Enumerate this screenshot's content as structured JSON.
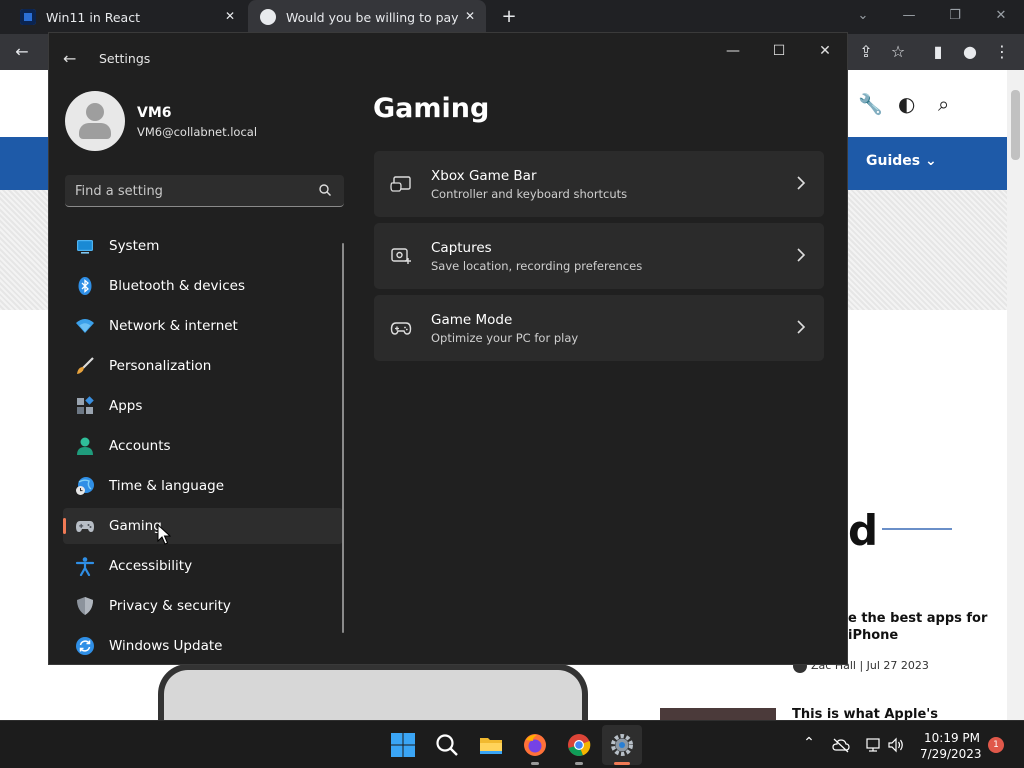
{
  "browser": {
    "tabs": [
      {
        "title": "Win11 in React",
        "favicon_color": "#2b6fd6"
      },
      {
        "title": "Would you be willing to pay a hig",
        "favicon_color": "#1e5aa8"
      }
    ],
    "close_glyph": "✕",
    "new_tab_glyph": "+"
  },
  "webpage": {
    "nav_guides": "Guides",
    "heading_fragment": "d",
    "article_title": "e the best apps for iPhone",
    "article_meta": "Zac Hall | Jul 27 2023",
    "article2_title": "This is what Apple's"
  },
  "settings": {
    "window_title": "Settings",
    "user": {
      "name": "VM6",
      "email": "VM6@collabnet.local"
    },
    "search_placeholder": "Find a setting",
    "accent_color": "#f07a55",
    "nav": [
      {
        "label": "System",
        "icon": "system-icon"
      },
      {
        "label": "Bluetooth & devices",
        "icon": "bluetooth-icon"
      },
      {
        "label": "Network & internet",
        "icon": "wifi-icon"
      },
      {
        "label": "Personalization",
        "icon": "brush-icon"
      },
      {
        "label": "Apps",
        "icon": "apps-icon"
      },
      {
        "label": "Accounts",
        "icon": "account-icon"
      },
      {
        "label": "Time & language",
        "icon": "globe-clock-icon"
      },
      {
        "label": "Gaming",
        "icon": "gamepad-icon",
        "selected": true
      },
      {
        "label": "Accessibility",
        "icon": "accessibility-icon"
      },
      {
        "label": "Privacy & security",
        "icon": "shield-icon"
      },
      {
        "label": "Windows Update",
        "icon": "update-icon"
      }
    ],
    "page_title": "Gaming",
    "cards": [
      {
        "title": "Xbox Game Bar",
        "subtitle": "Controller and keyboard shortcuts",
        "icon": "game-bar-icon"
      },
      {
        "title": "Captures",
        "subtitle": "Save location, recording preferences",
        "icon": "capture-icon"
      },
      {
        "title": "Game Mode",
        "subtitle": "Optimize your PC for play",
        "icon": "gamepad-icon"
      }
    ]
  },
  "taskbar": {
    "time": "10:19 PM",
    "date": "7/29/2023",
    "notification_count": "1"
  }
}
